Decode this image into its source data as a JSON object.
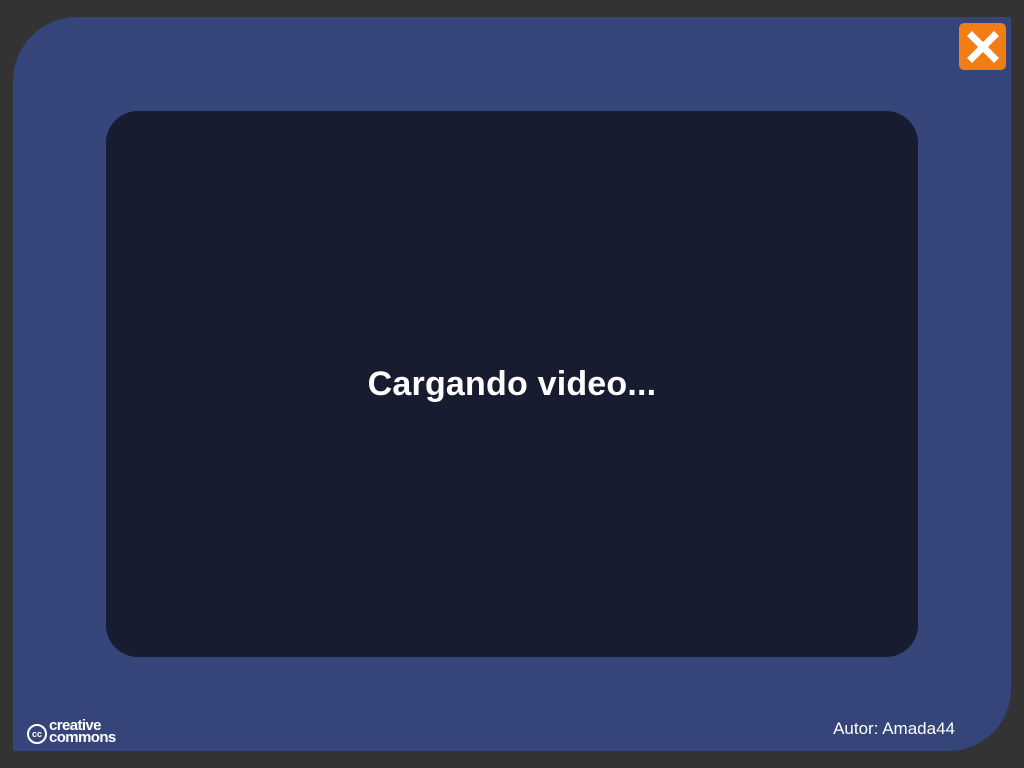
{
  "player": {
    "loading_text": "Cargando video...",
    "close_icon": "close-icon",
    "author_label": "Autor: Amada44"
  },
  "license": {
    "icon": "cc-icon",
    "badge": "cc",
    "line1": "creative",
    "line2": "commons"
  },
  "colors": {
    "background": "#333333",
    "frame": "#354579",
    "video_area": "#181c30",
    "close_button": "#f17d14",
    "text": "#ffffff"
  }
}
